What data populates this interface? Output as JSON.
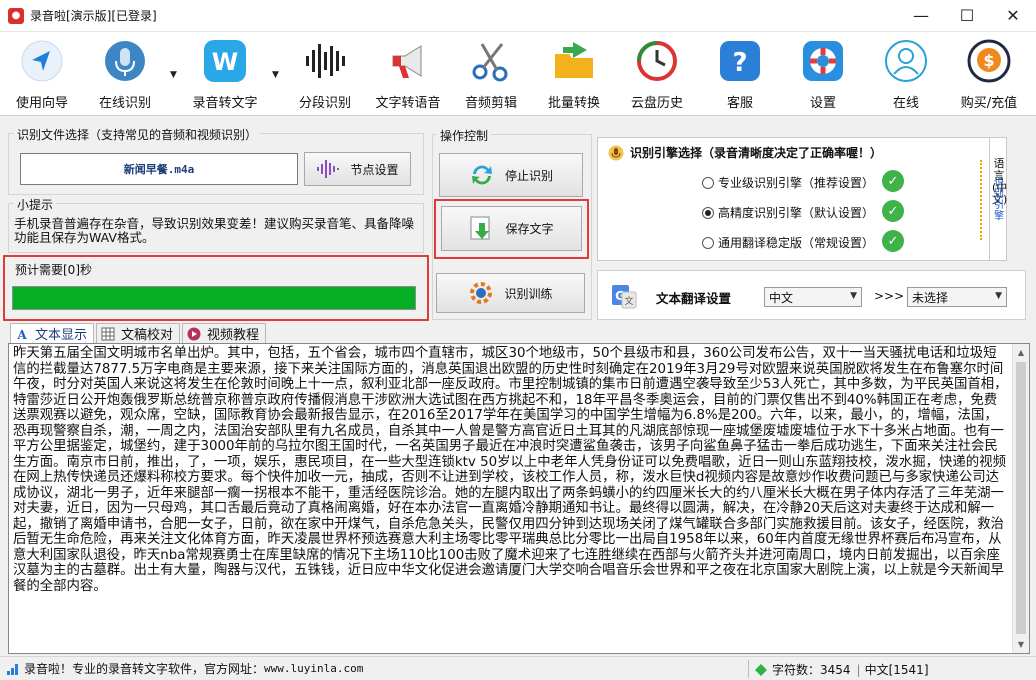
{
  "window": {
    "title": "录音啦[演示版][已登录]",
    "minimize": "—",
    "maximize": "☐",
    "close": "✕"
  },
  "toolbar": {
    "items": [
      {
        "label": "使用向导",
        "icon": "navigation-arrow-icon"
      },
      {
        "label": "在线识别",
        "icon": "microphone-icon"
      },
      {
        "label": "录音转文字",
        "icon": "w-letter-icon"
      },
      {
        "label": "分段识别",
        "icon": "waveform-icon"
      },
      {
        "label": "文字转语音",
        "icon": "megaphone-icon"
      },
      {
        "label": "音频剪辑",
        "icon": "scissors-icon"
      },
      {
        "label": "批量转换",
        "icon": "folder-arrow-icon"
      },
      {
        "label": "云盘历史",
        "icon": "history-clock-icon"
      },
      {
        "label": "客服",
        "icon": "help-question-icon"
      },
      {
        "label": "设置",
        "icon": "lifebuoy-settings-icon"
      },
      {
        "label": "在线",
        "icon": "user-online-icon"
      },
      {
        "label": "购买/充值",
        "icon": "dollar-coin-icon"
      }
    ]
  },
  "file_group": {
    "title": "识别文件选择（支持常见的音频和视频识别）",
    "file_name": "新闻早餐.m4a",
    "node_button": "节点设置"
  },
  "tip_group": {
    "title": "小提示",
    "text": "手机录音普遍存在杂音，导致识别效果变差！建议购买录音笔、具备降噪功能且保存为WAV格式。"
  },
  "progress_group": {
    "title": "预计需要[0]秒",
    "progress_fraction": 1.0
  },
  "operation_group": {
    "title": "操作控制",
    "stop_button": "停止识别",
    "save_button": "保存文字",
    "train_button": "识别训练"
  },
  "engine": {
    "title": "识别引擎选择（录音清晰度决定了正确率喔！）",
    "options": [
      {
        "label": "专业级识别引擎（推荐设置）",
        "selected": false
      },
      {
        "label": "高精度识别引擎（默认设置）",
        "selected": true
      },
      {
        "label": "通用翻译稳定版（常规设置）",
        "selected": false
      }
    ],
    "side_tab_language": "语言(中文)",
    "side_tab_engine": "识别引擎"
  },
  "translate": {
    "label": "文本翻译设置",
    "source_value": "中文",
    "arrows": ">>>",
    "target_value": "未选择"
  },
  "tabs": [
    {
      "label": "文本显示",
      "active": true
    },
    {
      "label": "文稿校对",
      "active": false
    },
    {
      "label": "视频教程",
      "active": false
    }
  ],
  "transcript": {
    "text": "昨天第五届全国文明城市名单出炉。其中，包括，五个省会，城市四个直辖市，城区30个地级市，50个县级市和县，360公司发布公告，双十一当天骚扰电话和垃圾短信的拦截量达7877.5万字电商是主要来源，接下来关注国际方面的，消息英国退出欧盟的历史性时刻确定在2019年3月29号对欧盟来说英国脱欧将发生在布鲁塞尔时间午夜，时分对英国人来说这将发生在伦敦时间晚上十一点，叙利亚北部一座反政府。市里控制城镇的集市日前遭遇空袭导致至少53人死亡，其中多数，为平民英国首相，特雷莎近日公开炮轰俄罗斯总统普京称普京政府传播假消息干涉欧洲大选试图在西方挑起不和，18年平昌冬季奥运会，目前的门票仅售出不到40%韩国正在考虑，免费送票观赛以避免，观众席，空缺，国际教育协会最新报告显示，在2016至2017学年在美国学习的中国学生增幅为6.8%是200。六年，以来，最小，的，增幅，法国，恐再现警察自杀，潮，一周之内，法国治安部队里有九名成员，自杀其中一人曾是警方高官近日土耳其的凡湖底部惊现一座城堡废墟废墟位于水下十多米占地面。也有一平方公里据鉴定，城堡约，建于3000年前的乌拉尔图王国时代，一名英国男子最近在冲浪时突遭鲨鱼袭击，该男子向鲨鱼鼻子猛击一拳后成功逃生，下面来关注社会民生方面。南京市日前，推出，了，一项，娱乐，惠民项目，在一些大型连锁ktv 50岁以上中老年人凭身份证可以免费唱歌，近日一则山东蓝翔技校，泼水掘，快递的视频在网上热传快递员还爆料称校方要求。每个快件加收一元，抽成，否则不让进到学校，该校工作人员，称，泼水巨快d视频内容是故意炒作收费问题已与多家快递公司达成协议，湖北一男子，近年来腿部一瘸一拐根本不能干，重活经医院诊治。她的左腿内取出了两条蚂蟥小的约四厘米长大的约八厘米长大概在男子体内存活了三年芜湖一对夫妻，近日，因为一只母鸡，其口舌最后竟动了真格闹离婚，好在本办法官一直离婚冷静期通知书让。最终得以圆满，解决，在冷静20天后这对夫妻终于达成和解一起，撤销了离婚申请书，合肥一女子，日前，欲在家中开煤气，自杀危急关头，民警仅用四分钟到达现场关闭了煤气罐联合多部门实施救援目前。该女子，经医院，救治后暂无生命危险，再来关注文化体育方面，昨天凌晨世界杯预选赛意大利主场零比零平瑞典总比分零比一出局自1958年以来，60年内首度无缘世界杯赛后布冯宣布，从意大利国家队退役，昨天nba常规赛勇士在库里缺席的情况下主场110比100击败了魔术迎来了七连胜继续在西部与火箭齐头并进河南周口，境内日前发掘出，以百余座汉墓为主的古墓群。出土有大量，陶器与汉代，五铢钱，近日应中华文化促进会邀请厦门大学交响合唱音乐会世界和平之夜在北京国家大剧院上演，以上就是今天新闻早餐的全部内容。"
  },
  "status": {
    "app_text": "录音啦！专业的录音转文字软件，官方网址：",
    "website": "www.luyinla.com",
    "word_count": "字符数：3454",
    "language_info": "中文[1541]"
  },
  "colors": {
    "progress_green": "#06b025",
    "highlight_red": "#e03a3a",
    "check_green": "#3fb24a"
  }
}
